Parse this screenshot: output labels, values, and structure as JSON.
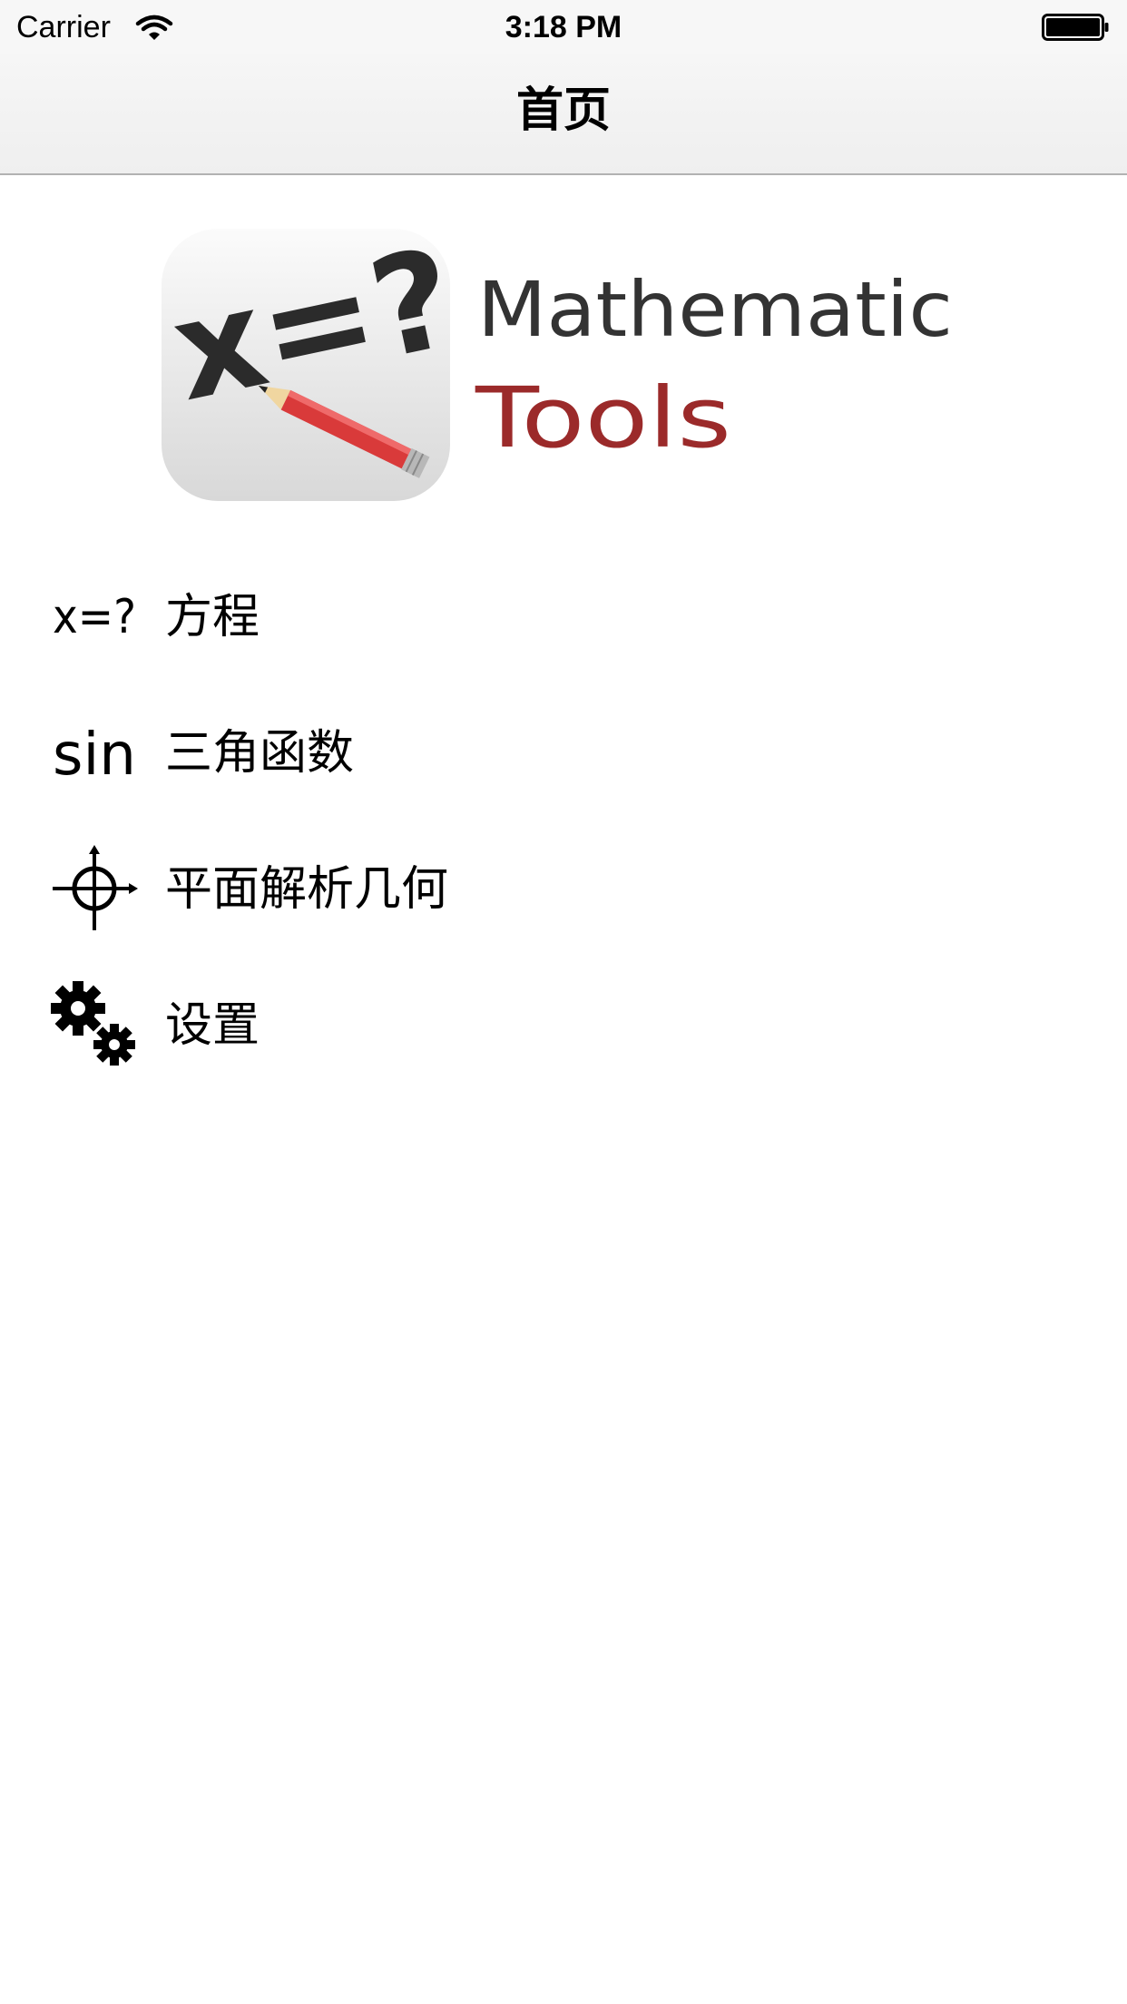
{
  "status_bar": {
    "carrier": "Carrier",
    "time": "3:18 PM",
    "wifi_icon": "wifi-icon",
    "battery_icon": "battery-icon"
  },
  "nav_bar": {
    "title": "首页"
  },
  "logo": {
    "line1": "Mathematic",
    "line2": "Tools",
    "equation": "x=?",
    "line1_color": "#333333",
    "line2_color": "#9b2a2a",
    "pencil_color": "#d93a3a"
  },
  "menu": {
    "items": [
      {
        "icon": "equation-icon",
        "icon_text": "x=?",
        "label": "方程"
      },
      {
        "icon": "sine-icon",
        "icon_text": "sin",
        "label": "三角函数"
      },
      {
        "icon": "crosshair-icon",
        "label": "平面解析几何"
      },
      {
        "icon": "gears-icon",
        "label": "设置"
      }
    ]
  }
}
